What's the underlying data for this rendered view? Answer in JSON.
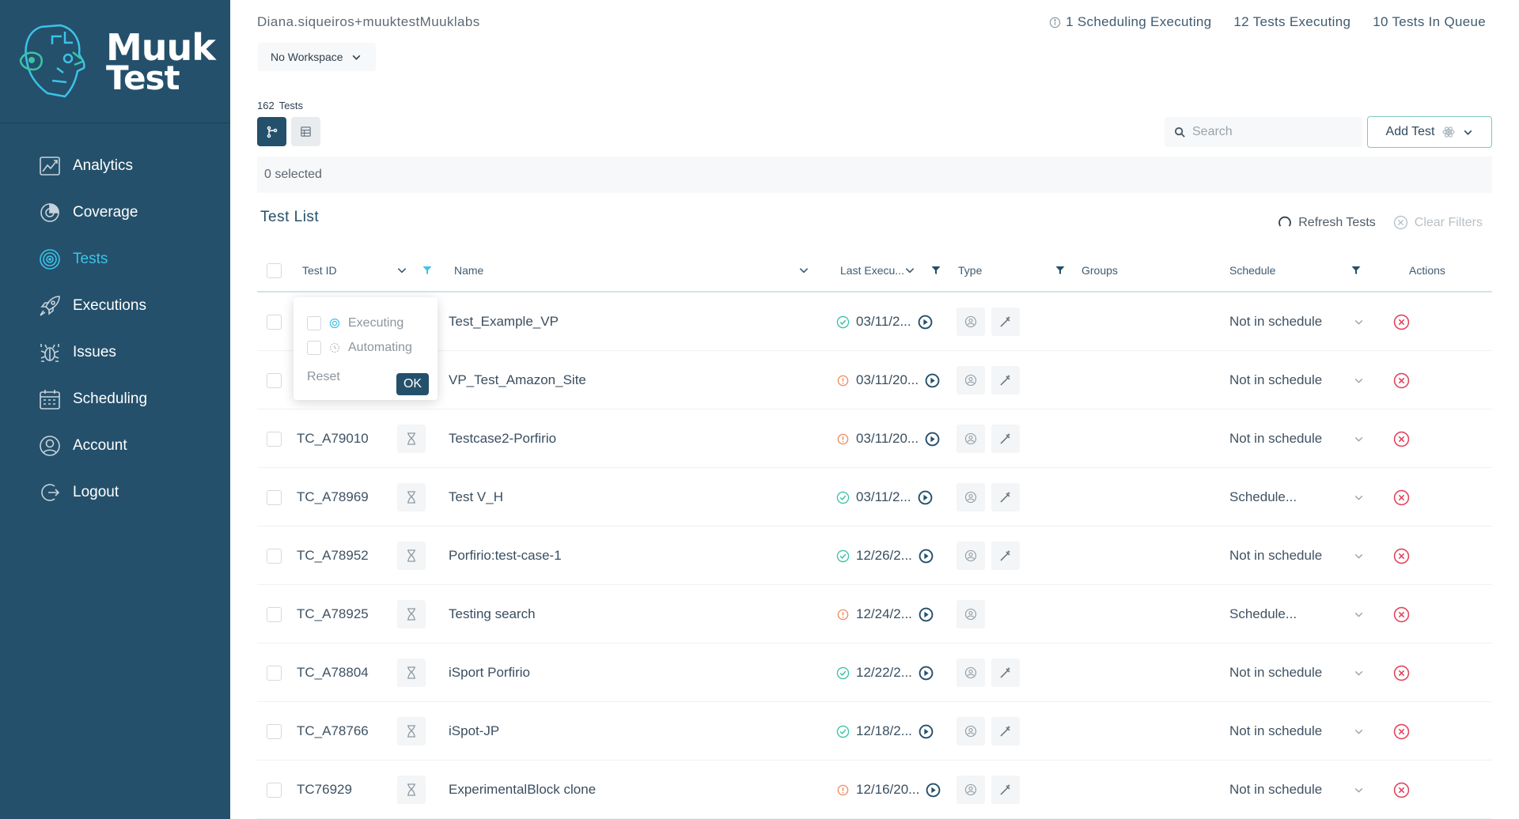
{
  "brand": {
    "line1": "Muuk",
    "line2": "Test"
  },
  "sidebar": {
    "items": [
      {
        "label": "Analytics",
        "icon": "chart-icon",
        "active": false
      },
      {
        "label": "Coverage",
        "icon": "pie-icon",
        "active": false
      },
      {
        "label": "Tests",
        "icon": "target-icon",
        "active": true
      },
      {
        "label": "Executions",
        "icon": "rocket-icon",
        "active": false
      },
      {
        "label": "Issues",
        "icon": "bug-icon",
        "active": false
      },
      {
        "label": "Scheduling",
        "icon": "calendar-icon",
        "active": false
      },
      {
        "label": "Account",
        "icon": "user-icon",
        "active": false
      },
      {
        "label": "Logout",
        "icon": "logout-icon",
        "active": false
      }
    ]
  },
  "header": {
    "user": "Diana.siqueiros+muuktestMuuklabs",
    "workspace": "No Workspace",
    "status": {
      "scheduling": "1 Scheduling Executing",
      "executing": "12 Tests Executing",
      "queue": "10 Tests In Queue"
    }
  },
  "toolbar": {
    "count_number": "162",
    "count_label": "Tests",
    "search_placeholder": "Search",
    "add_test": "Add Test",
    "selected": "0 selected"
  },
  "list": {
    "title": "Test List",
    "refresh": "Refresh Tests",
    "clear": "Clear Filters"
  },
  "table": {
    "columns": {
      "id": "Test ID",
      "name": "Name",
      "last": "Last Execu...",
      "type": "Type",
      "groups": "Groups",
      "schedule": "Schedule",
      "actions": "Actions"
    },
    "rows": [
      {
        "id": "",
        "name": "Test_Example_VP",
        "date": "03/11/2...",
        "status": "pass",
        "edit": true,
        "schedule": "Not in schedule"
      },
      {
        "id": "",
        "name": "VP_Test_Amazon_Site",
        "date": "03/11/20...",
        "status": "fail",
        "edit": true,
        "schedule": "Not in schedule"
      },
      {
        "id": "TC_A79010",
        "name": "Testcase2-Porfirio",
        "date": "03/11/20...",
        "status": "fail",
        "edit": true,
        "schedule": "Not in schedule"
      },
      {
        "id": "TC_A78969",
        "name": "Test V_H",
        "date": "03/11/2...",
        "status": "pass",
        "edit": true,
        "schedule": "Schedule..."
      },
      {
        "id": "TC_A78952",
        "name": "Porfirio:test-case-1",
        "date": "12/26/2...",
        "status": "pass",
        "edit": true,
        "schedule": "Not in schedule"
      },
      {
        "id": "TC_A78925",
        "name": "Testing search",
        "date": "12/24/2...",
        "status": "fail",
        "edit": false,
        "schedule": "Schedule..."
      },
      {
        "id": "TC_A78804",
        "name": "iSport Porfirio",
        "date": "12/22/2...",
        "status": "pass",
        "edit": true,
        "schedule": "Not in schedule"
      },
      {
        "id": "TC_A78766",
        "name": "iSpot-JP",
        "date": "12/18/2...",
        "status": "pass",
        "edit": true,
        "schedule": "Not in schedule"
      },
      {
        "id": "TC76929",
        "name": "ExperimentalBlock clone",
        "date": "12/16/20...",
        "status": "fail",
        "edit": true,
        "schedule": "Not in schedule"
      }
    ]
  },
  "popover": {
    "option1": "Executing",
    "option2": "Automating",
    "reset": "Reset",
    "ok": "OK"
  },
  "colors": {
    "sidebar": "#24506b",
    "accent": "#3cc3e8",
    "pass": "#3cc3a5",
    "fail": "#f08a5d",
    "danger": "#e2445c"
  }
}
